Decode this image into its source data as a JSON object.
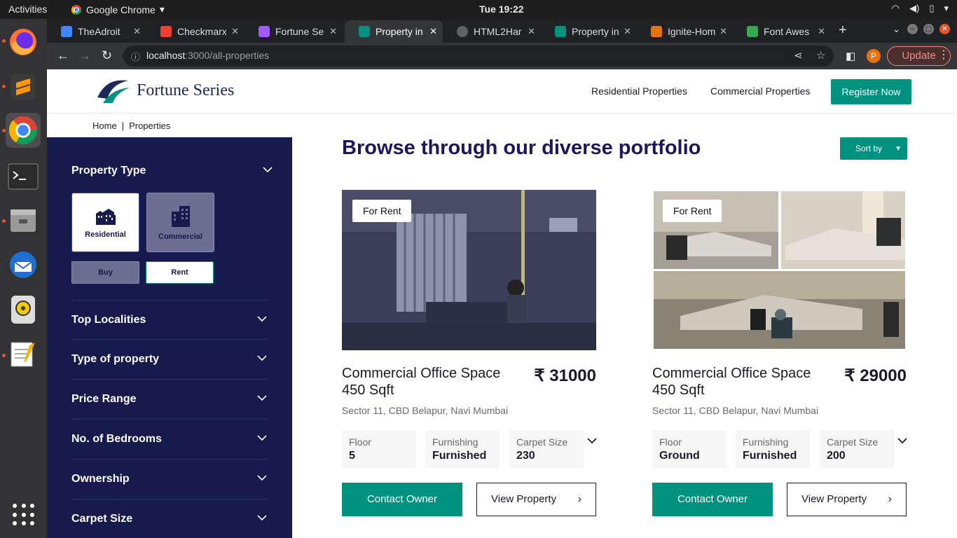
{
  "system": {
    "activities": "Activities",
    "app_name": "Google Chrome",
    "clock": "Tue 19:22"
  },
  "browser": {
    "tabs": [
      {
        "title": "TheAdroit",
        "favicon_color": "#4285f4"
      },
      {
        "title": "Checkmarx",
        "favicon_color": "#ea4335"
      },
      {
        "title": "Fortune Se",
        "favicon_color": "#a259ff"
      },
      {
        "title": "Property in",
        "favicon_color": "#00917f"
      },
      {
        "title": "HTML2Har",
        "favicon_color": "#5f6368"
      },
      {
        "title": "Property in",
        "favicon_color": "#00917f"
      },
      {
        "title": "Ignite-Hom",
        "favicon_color": "#e8710a"
      },
      {
        "title": "Font Awes",
        "favicon_color": "#34a853"
      }
    ],
    "active_tab_index": 3,
    "url_host": "localhost",
    "url_path": ":3000/all-properties",
    "profile_initial": "P",
    "update_label": "Update"
  },
  "site": {
    "brand": "Fortune Series",
    "nav": {
      "residential": "Residential Properties",
      "commercial": "Commercial Properties",
      "register": "Register Now"
    },
    "breadcrumb": {
      "home": "Home",
      "sep": "|",
      "current": "Properties"
    },
    "sidebar": {
      "property_type_label": "Property Type",
      "type_options": {
        "residential": "Residential",
        "commercial": "Commercial"
      },
      "selected_type": "Residential",
      "deal_options": {
        "buy": "Buy",
        "rent": "Rent"
      },
      "selected_deal": "Rent",
      "filters": [
        "Top Localities",
        "Type of property",
        "Price Range",
        "No. of Bedrooms",
        "Ownership",
        "Carpet Size"
      ]
    },
    "main": {
      "heading": "Browse through our diverse portfolio",
      "sort_label": "Sort by"
    },
    "cards": [
      {
        "badge": "For Rent",
        "title": "Commercial Office Space 450 Sqft",
        "price": "₹ 31000",
        "location": "Sector 11, CBD Belapur, Navi Mumbai",
        "specs": [
          {
            "key": "Floor",
            "value": "5"
          },
          {
            "key": "Furnishing",
            "value": "Furnished"
          },
          {
            "key": "Carpet Size",
            "value": "230"
          }
        ],
        "contact_label": "Contact Owner",
        "view_label": "View Property"
      },
      {
        "badge": "For Rent",
        "title": "Commercial Office Space 450 Sqft",
        "price": "₹ 29000",
        "location": "Sector 11, CBD Belapur, Navi Mumbai",
        "specs": [
          {
            "key": "Floor",
            "value": "Ground"
          },
          {
            "key": "Furnishing",
            "value": "Furnished"
          },
          {
            "key": "Carpet Size",
            "value": "200"
          }
        ],
        "contact_label": "Contact Owner",
        "view_label": "View Property"
      }
    ],
    "colors": {
      "brand_teal": "#00917f",
      "sidebar_navy": "#161a4c",
      "heading_navy": "#1c1560"
    }
  }
}
